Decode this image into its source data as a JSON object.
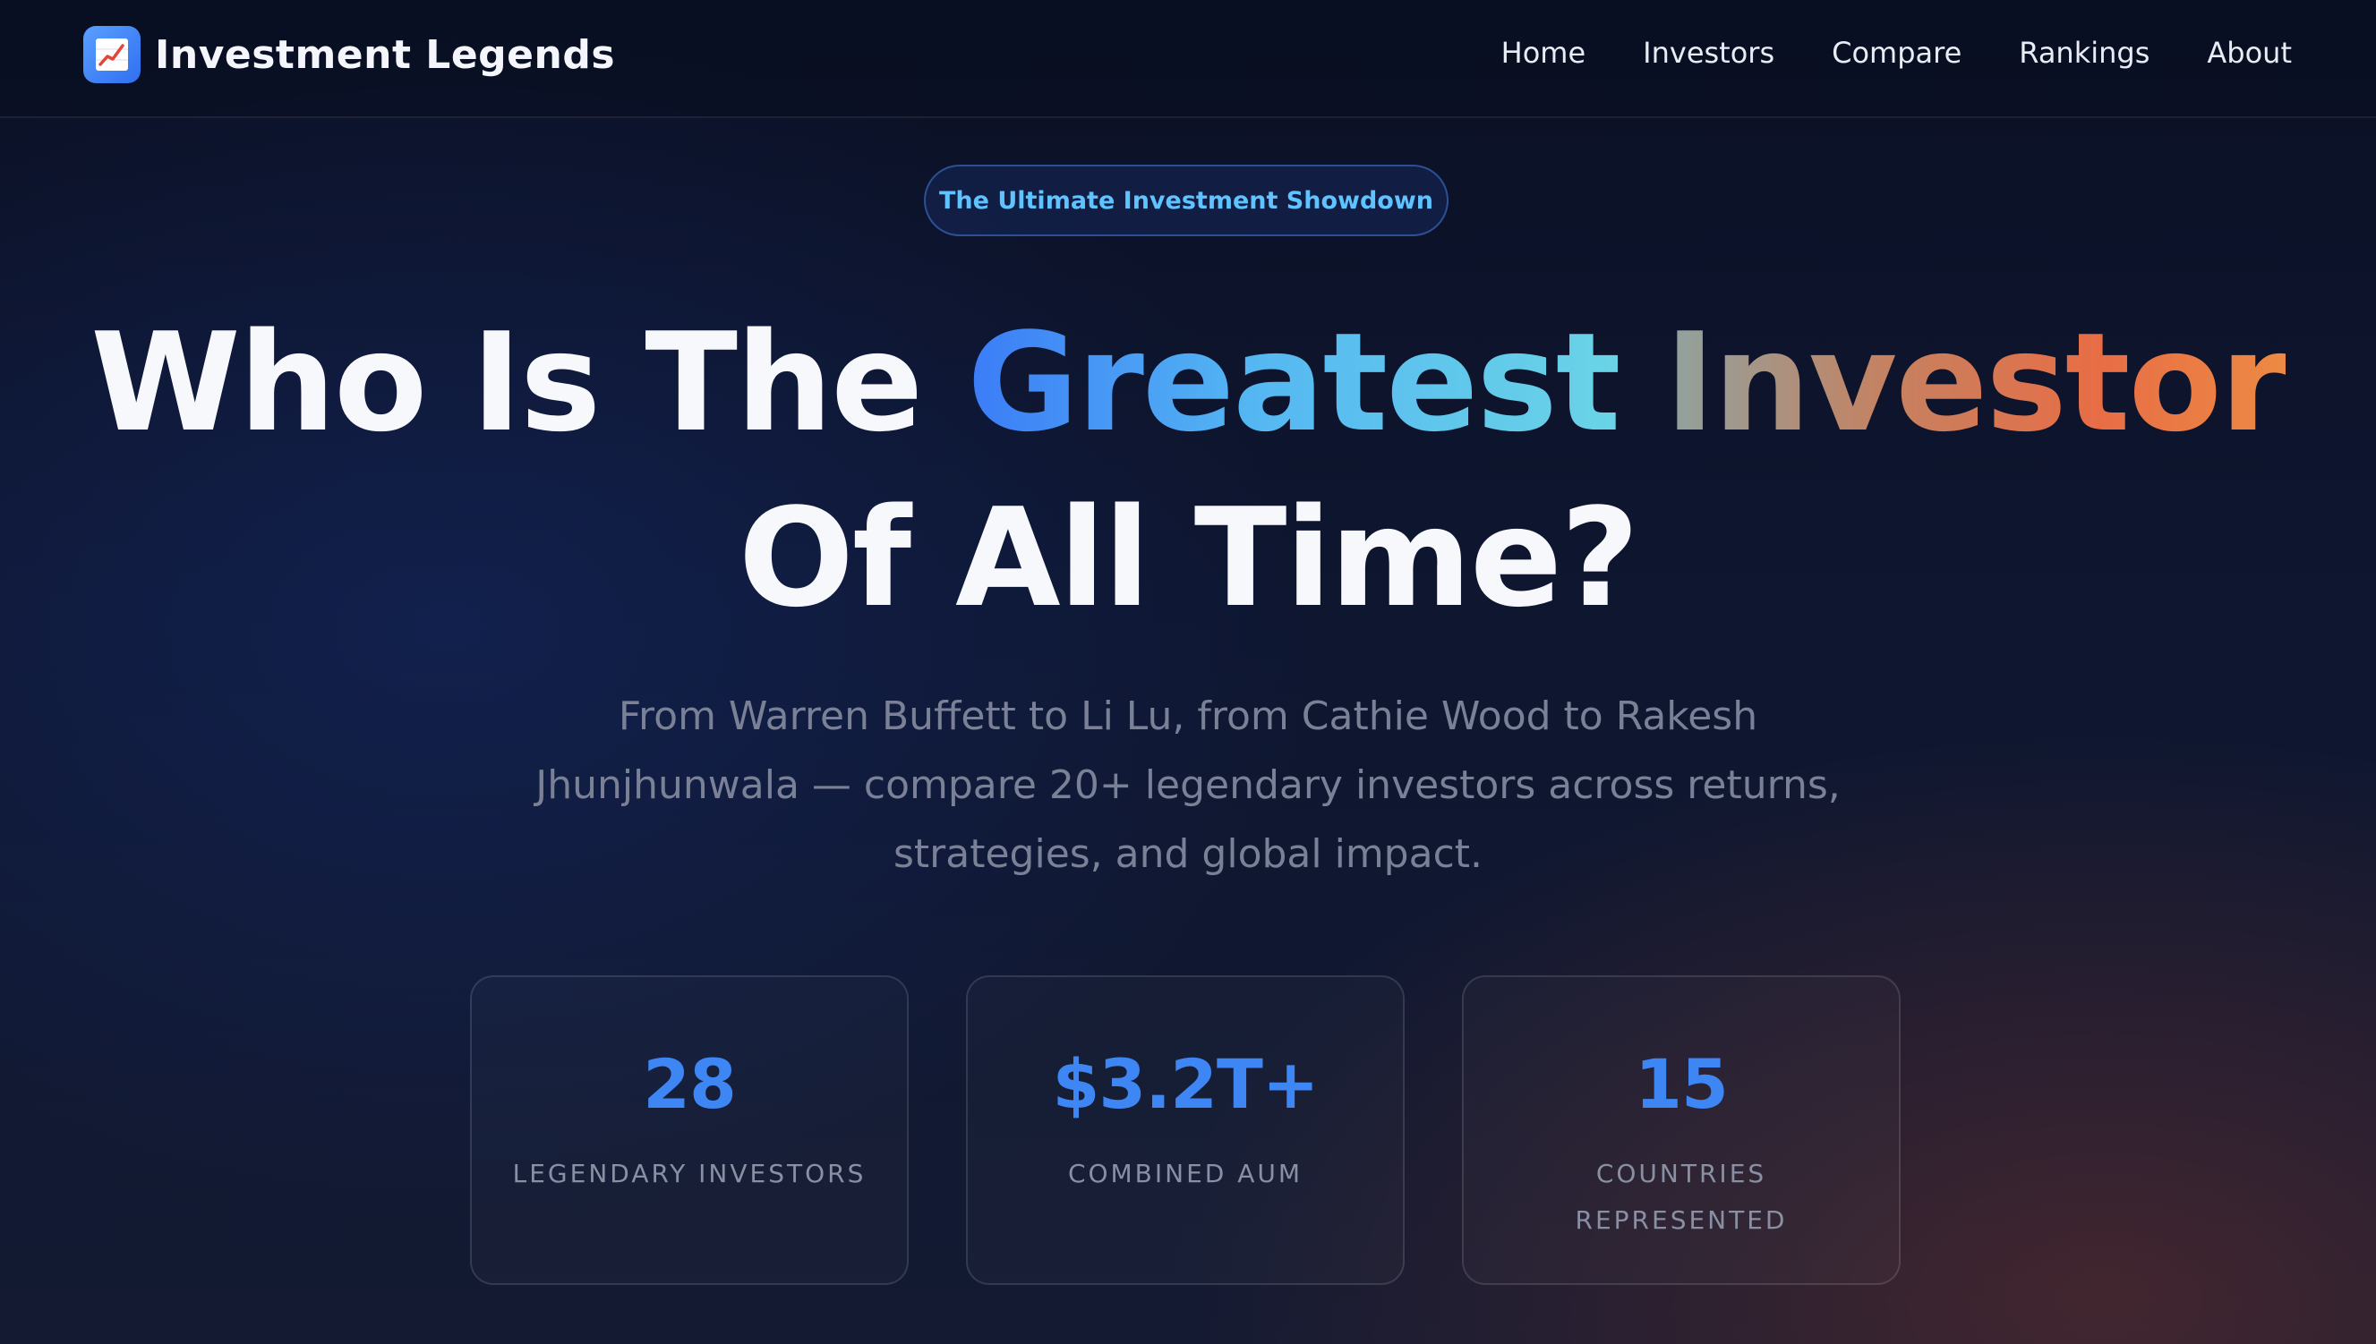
{
  "navbar": {
    "brand": {
      "logo_icon": "chart-increasing-icon",
      "name": "Investment Legends"
    },
    "links": [
      "Home",
      "Investors",
      "Compare",
      "Rankings",
      "About"
    ]
  },
  "hero": {
    "badge": "The Ultimate Investment Showdown",
    "headline": {
      "part1": "Who Is The ",
      "highlight1": "Greatest",
      "space": " ",
      "highlight2": "Investor",
      "line2": "Of All Time?"
    },
    "subtitle": "From Warren Buffett to Li Lu, from Cathie Wood to Rakesh Jhunjhunwala — compare 20+ legendary investors across returns, strategies, and global impact."
  },
  "stats": [
    {
      "value": "28",
      "label": "LEGENDARY INVESTORS"
    },
    {
      "value": "$3.2T+",
      "label": "COMBINED AUM"
    },
    {
      "value": "15",
      "label": "COUNTRIES REPRESENTED"
    }
  ],
  "colors": {
    "accent_blue": "#3f86f5",
    "badge_text": "#5ec3ff",
    "gradient_orange": "#e86d45",
    "background": "#0d1224"
  }
}
